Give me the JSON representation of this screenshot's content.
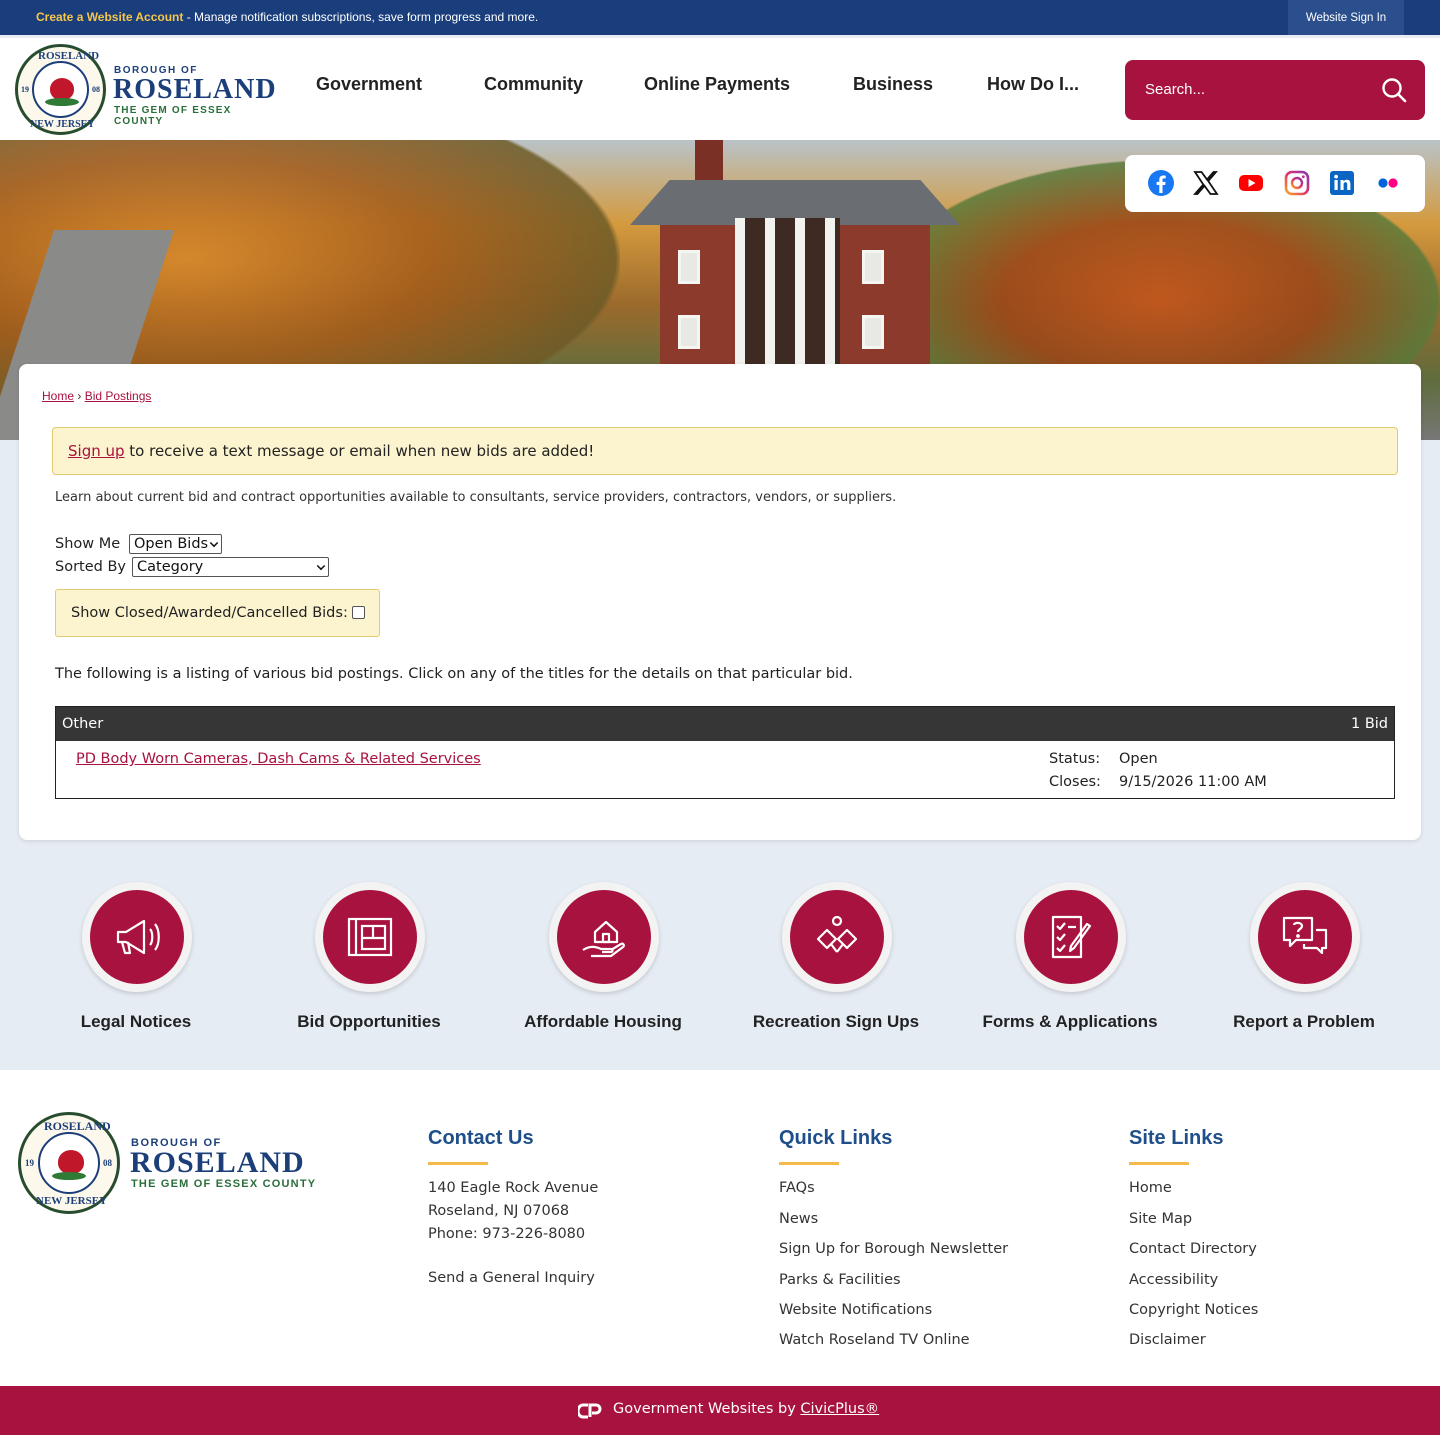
{
  "topbar": {
    "create_account": "Create a Website Account",
    "message": " - Manage notification subscriptions, save form progress and more.",
    "signin": "Website Sign In"
  },
  "logo": {
    "borough": "BOROUGH OF",
    "name": "ROSELAND",
    "tagline": "THE GEM OF ESSEX COUNTY",
    "seal_top": "ROSELAND",
    "seal_bottom": "NEW JERSEY",
    "seal_left": "19",
    "seal_right": "08"
  },
  "nav": [
    "Government",
    "Community",
    "Online Payments",
    "Business",
    "How Do I..."
  ],
  "search": {
    "placeholder": "Search..."
  },
  "social": [
    "facebook-icon",
    "x-icon",
    "youtube-icon",
    "instagram-icon",
    "linkedin-icon",
    "flickr-icon"
  ],
  "breadcrumb": {
    "home": "Home",
    "sep": "›",
    "current": "Bid Postings"
  },
  "notice": {
    "link": "Sign up",
    "text": " to receive a text message or email when new bids are added!"
  },
  "intro": "Learn about current bid and contract opportunities available to consultants, service providers, contractors, vendors, or suppliers.",
  "filters": {
    "show_me_label": "Show Me",
    "show_me_value": "Open Bids",
    "sorted_by_label": "Sorted By",
    "sorted_by_value": "Category",
    "closed_label": "Show Closed/Awarded/Cancelled Bids:"
  },
  "listing_text": "The following is a listing of various bid postings. Click on any of the titles for the details on that particular bid.",
  "bids": {
    "category": "Other",
    "count": "1 Bid",
    "items": [
      {
        "title": "PD Body Worn Cameras, Dash Cams & Related Services",
        "status_label": "Status:",
        "status": "Open",
        "closes_label": "Closes:",
        "closes": "9/15/2026 11:00 AM"
      }
    ]
  },
  "quick_links": [
    {
      "label": "Legal Notices",
      "icon": "megaphone-icon"
    },
    {
      "label": "Bid Opportunities",
      "icon": "blueprint-icon"
    },
    {
      "label": "Affordable Housing",
      "icon": "house-hand-icon"
    },
    {
      "label": "Recreation Sign Ups",
      "icon": "pickleball-icon"
    },
    {
      "label": "Forms & Applications",
      "icon": "checklist-icon"
    },
    {
      "label": "Report a Problem",
      "icon": "question-chat-icon"
    }
  ],
  "footer": {
    "contact": {
      "title": "Contact Us",
      "address1": "140 Eagle Rock Avenue",
      "address2": "Roseland, NJ 07068",
      "phone": "Phone: 973-226-8080",
      "inquiry": "Send a General Inquiry"
    },
    "quick": {
      "title": "Quick Links",
      "items": [
        "FAQs",
        "News",
        "Sign Up for Borough Newsletter",
        "Parks & Facilities",
        "Website Notifications",
        "Watch Roseland TV Online"
      ]
    },
    "site": {
      "title": "Site Links",
      "items": [
        "Home",
        "Site Map",
        "Contact Directory",
        "Accessibility",
        "Copyright Notices",
        "Disclaimer"
      ]
    }
  },
  "bottom": {
    "prefix": "Government Websites by ",
    "link": "CivicPlus®"
  },
  "colors": {
    "brand": "#a8123e",
    "navy": "#1a3e7c",
    "footer_title": "#1f4f8a",
    "accent": "#f5b84a"
  }
}
